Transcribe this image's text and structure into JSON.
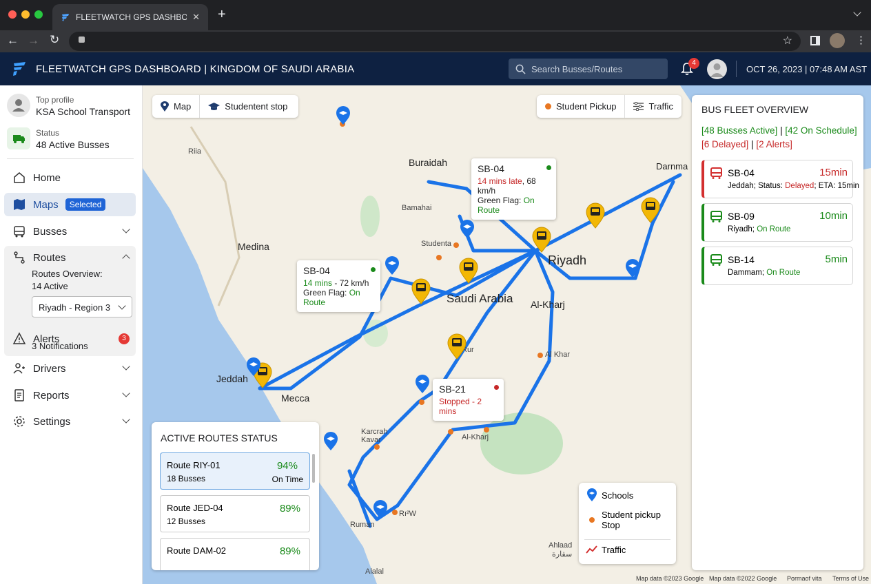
{
  "browser": {
    "tab_title": "FLEETWATCH GPS DASHBOARD",
    "new_tab": "+"
  },
  "header": {
    "title": "FLEETWATCH GPS DASHBOARD | KINGDOM OF SAUDI ARABIA",
    "search_placeholder": "Search Busses/Routes",
    "notif_count": "4",
    "datetime": "OCT 26, 2023 | 07:48 AM AST"
  },
  "sidebar": {
    "profile_label": "Top profile",
    "profile_name": "KSA School Transport",
    "status_label": "Status",
    "status_value": "48 Active Busses",
    "home": "Home",
    "maps": "Maps",
    "maps_badge": "Selected",
    "busses": "Busses",
    "routes": "Routes",
    "routes_overview": "Routes Overview:",
    "routes_active": "14 Active",
    "region_select": "Riyadh - Region 3",
    "alerts": "Alerts",
    "alerts_sub": "3 Notifications",
    "alerts_count": "3",
    "drivers": "Drivers",
    "reports": "Reports",
    "settings": "Settings"
  },
  "map_controls": {
    "map_btn": "Map",
    "stop_btn": "Studentent stop",
    "pickup_btn": "Student Pickup",
    "traffic_btn": "Traffic"
  },
  "fleet": {
    "title": "BUS FLEET OVERVIEW",
    "active": "[48 Busses Active]",
    "sep1": " | ",
    "on_schedule": "[42 On Schedule]",
    "delayed": "[6 Delayed]",
    "sep2": " | ",
    "alerts": "[2 Alerts]",
    "buses": [
      {
        "id": "SB-04",
        "eta": "15min",
        "city": "Jeddah; Status: ",
        "status": "Delayed",
        "extra": "; ETA: 15min"
      },
      {
        "id": "SB-09",
        "eta": "10min",
        "city": "Riyadh; ",
        "status": "On Route",
        "extra": ""
      },
      {
        "id": "SB-14",
        "eta": "5min",
        "city": "Dammam; ",
        "status": "On Route",
        "extra": ""
      }
    ]
  },
  "routes_status": {
    "title": "ACTIVE ROUTES STATUS",
    "routes": [
      {
        "name": "Route RIY-01",
        "busses": "18 Busses",
        "pct": "94%",
        "note": "On Time"
      },
      {
        "name": "Route JED-04",
        "busses": "12 Busses",
        "pct": "89%",
        "note": ""
      },
      {
        "name": "Route DAM-02",
        "busses": "",
        "pct": "89%",
        "note": ""
      }
    ]
  },
  "callouts": {
    "c1": {
      "id": "SB-04",
      "l1": "14 mins late",
      "l1b": ", 68 km/h",
      "l2": "Green Flag: ",
      "l2b": "On Route"
    },
    "c2": {
      "id": "SB-04",
      "l1": "14 mins",
      "l1b": " - 72 km/h",
      "l2": "Green Flag: ",
      "l2b": "On Route"
    },
    "c3": {
      "id": "SB-21",
      "l1": "Stopped - 2 mins"
    }
  },
  "legend": {
    "schools": "Schools",
    "pickup": "Student pickup Stop",
    "traffic": "Traffic"
  },
  "map_labels": {
    "buraidah": "Buraidah",
    "riyadh": "Riyadh",
    "medina": "Medina",
    "saudi": "Saudi Arabia",
    "alkharj": "Al-Kharj",
    "alkharj2": "Al-Kharj",
    "alkhar": "Al Khar",
    "jeddah": "Jeddah",
    "mecca": "Mecca",
    "darnma": "Darnma",
    "bamahai": "Bamahai",
    "studenta": "Studenta",
    "riia": "Riia",
    "rur": "Rur",
    "karcrah": "Karcrah\nKavar",
    "ruman": "Ruman",
    "rizw": "Rı²W",
    "ahlaad": "Ahlaad",
    "ahlaad_ar": "سقارة",
    "alaal": "Alalal",
    "credit1": "Map data ©2023 Google",
    "credit2": "Map data ©2022 Google",
    "credit3": "Pormaof vita",
    "credit4": "Terms of Use"
  },
  "colors": {
    "appbar": "#0e2141",
    "route": "#1a73e8",
    "delayed": "#c62828",
    "ontime": "#1a8a1a",
    "bus_pin": "#f2b705"
  }
}
